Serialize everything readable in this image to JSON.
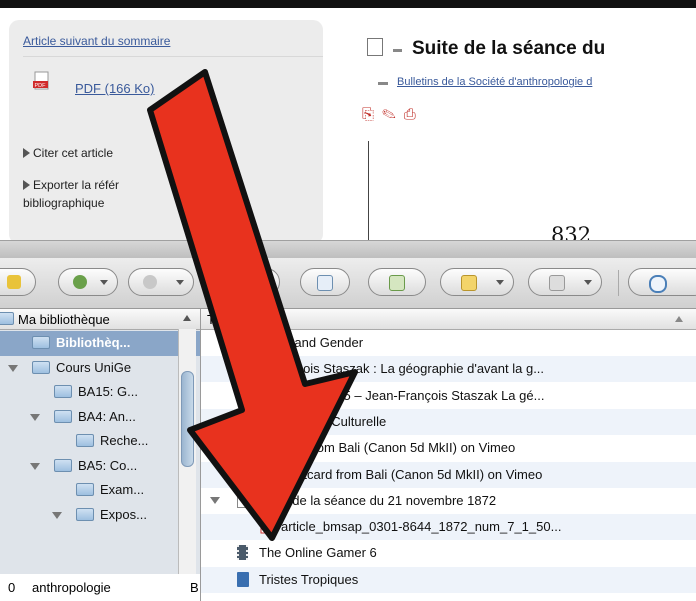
{
  "web": {
    "next_article": "Article suivant du sommaire",
    "pdf_link": "PDF  (166 Ko)",
    "cite": "Citer cet article",
    "export_line1": "Exporter la référ",
    "export_line2": "bibliographique",
    "title": "Suite de la séance du",
    "bulletins": "Bulletins de la Société d'anthropologie d",
    "page_number": "832"
  },
  "collections": {
    "header": "Ma bibliothèque",
    "rows": [
      {
        "label": "Bibliothèq...",
        "level": 1,
        "selected": true,
        "disclosure": false
      },
      {
        "label": "Cours UniGe",
        "level": 1,
        "disclosure": true
      },
      {
        "label": "BA15: G...",
        "level": 2,
        "disclosure": false
      },
      {
        "label": "BA4: An...",
        "level": 2,
        "disclosure": true
      },
      {
        "label": "Reche...",
        "level": 3,
        "disclosure": false
      },
      {
        "label": "BA5: Co...",
        "level": 2,
        "disclosure": true
      },
      {
        "label": "Exam...",
        "level": 3,
        "disclosure": false
      },
      {
        "label": "Expos...",
        "level": 3,
        "disclosure": true
      }
    ],
    "footer_left": "0",
    "footer_tag": "anthropologie",
    "footer_right": "B"
  },
  "items": {
    "header": "Ti",
    "rows": [
      {
        "label": "Geo...and Gender",
        "icon": "doc",
        "alt": false,
        "indent": 0
      },
      {
        "label": "...François Staszak : La géographie d'avant la g...",
        "icon": "doc",
        "alt": true,
        "indent": 0
      },
      {
        "label": "...ernard – 1995 – Jean-François Staszak  La gé...",
        "icon": "doc",
        "alt": false,
        "indent": 0
      },
      {
        "label": "...éographie Culturelle",
        "icon": "doc",
        "alt": true,
        "indent": 0
      },
      {
        "label": "...stcard from Bali (Canon 5d MkII) on Vimeo",
        "icon": "vimeo",
        "alt": false,
        "indent": 0,
        "disclosure": true
      },
      {
        "label": "Postcard from Bali (Canon 5d MkII) on Vimeo",
        "icon": "camera",
        "alt": true,
        "indent": 1
      },
      {
        "label": "Suite de la séance du 21 novembre 1872",
        "icon": "doc",
        "alt": false,
        "indent": 0,
        "disclosure": true
      },
      {
        "label": "article_bmsap_0301-8644_1872_num_7_1_50...",
        "icon": "pdf",
        "alt": true,
        "indent": 1
      },
      {
        "label": "The Online Gamer 6",
        "icon": "film",
        "alt": false,
        "indent": 0
      },
      {
        "label": "Tristes Tropiques",
        "icon": "book",
        "alt": true,
        "indent": 0
      }
    ]
  },
  "colors": {
    "arrow": "#e8321e",
    "link": "#3a5a9b",
    "selection": "#8aa6c8"
  }
}
